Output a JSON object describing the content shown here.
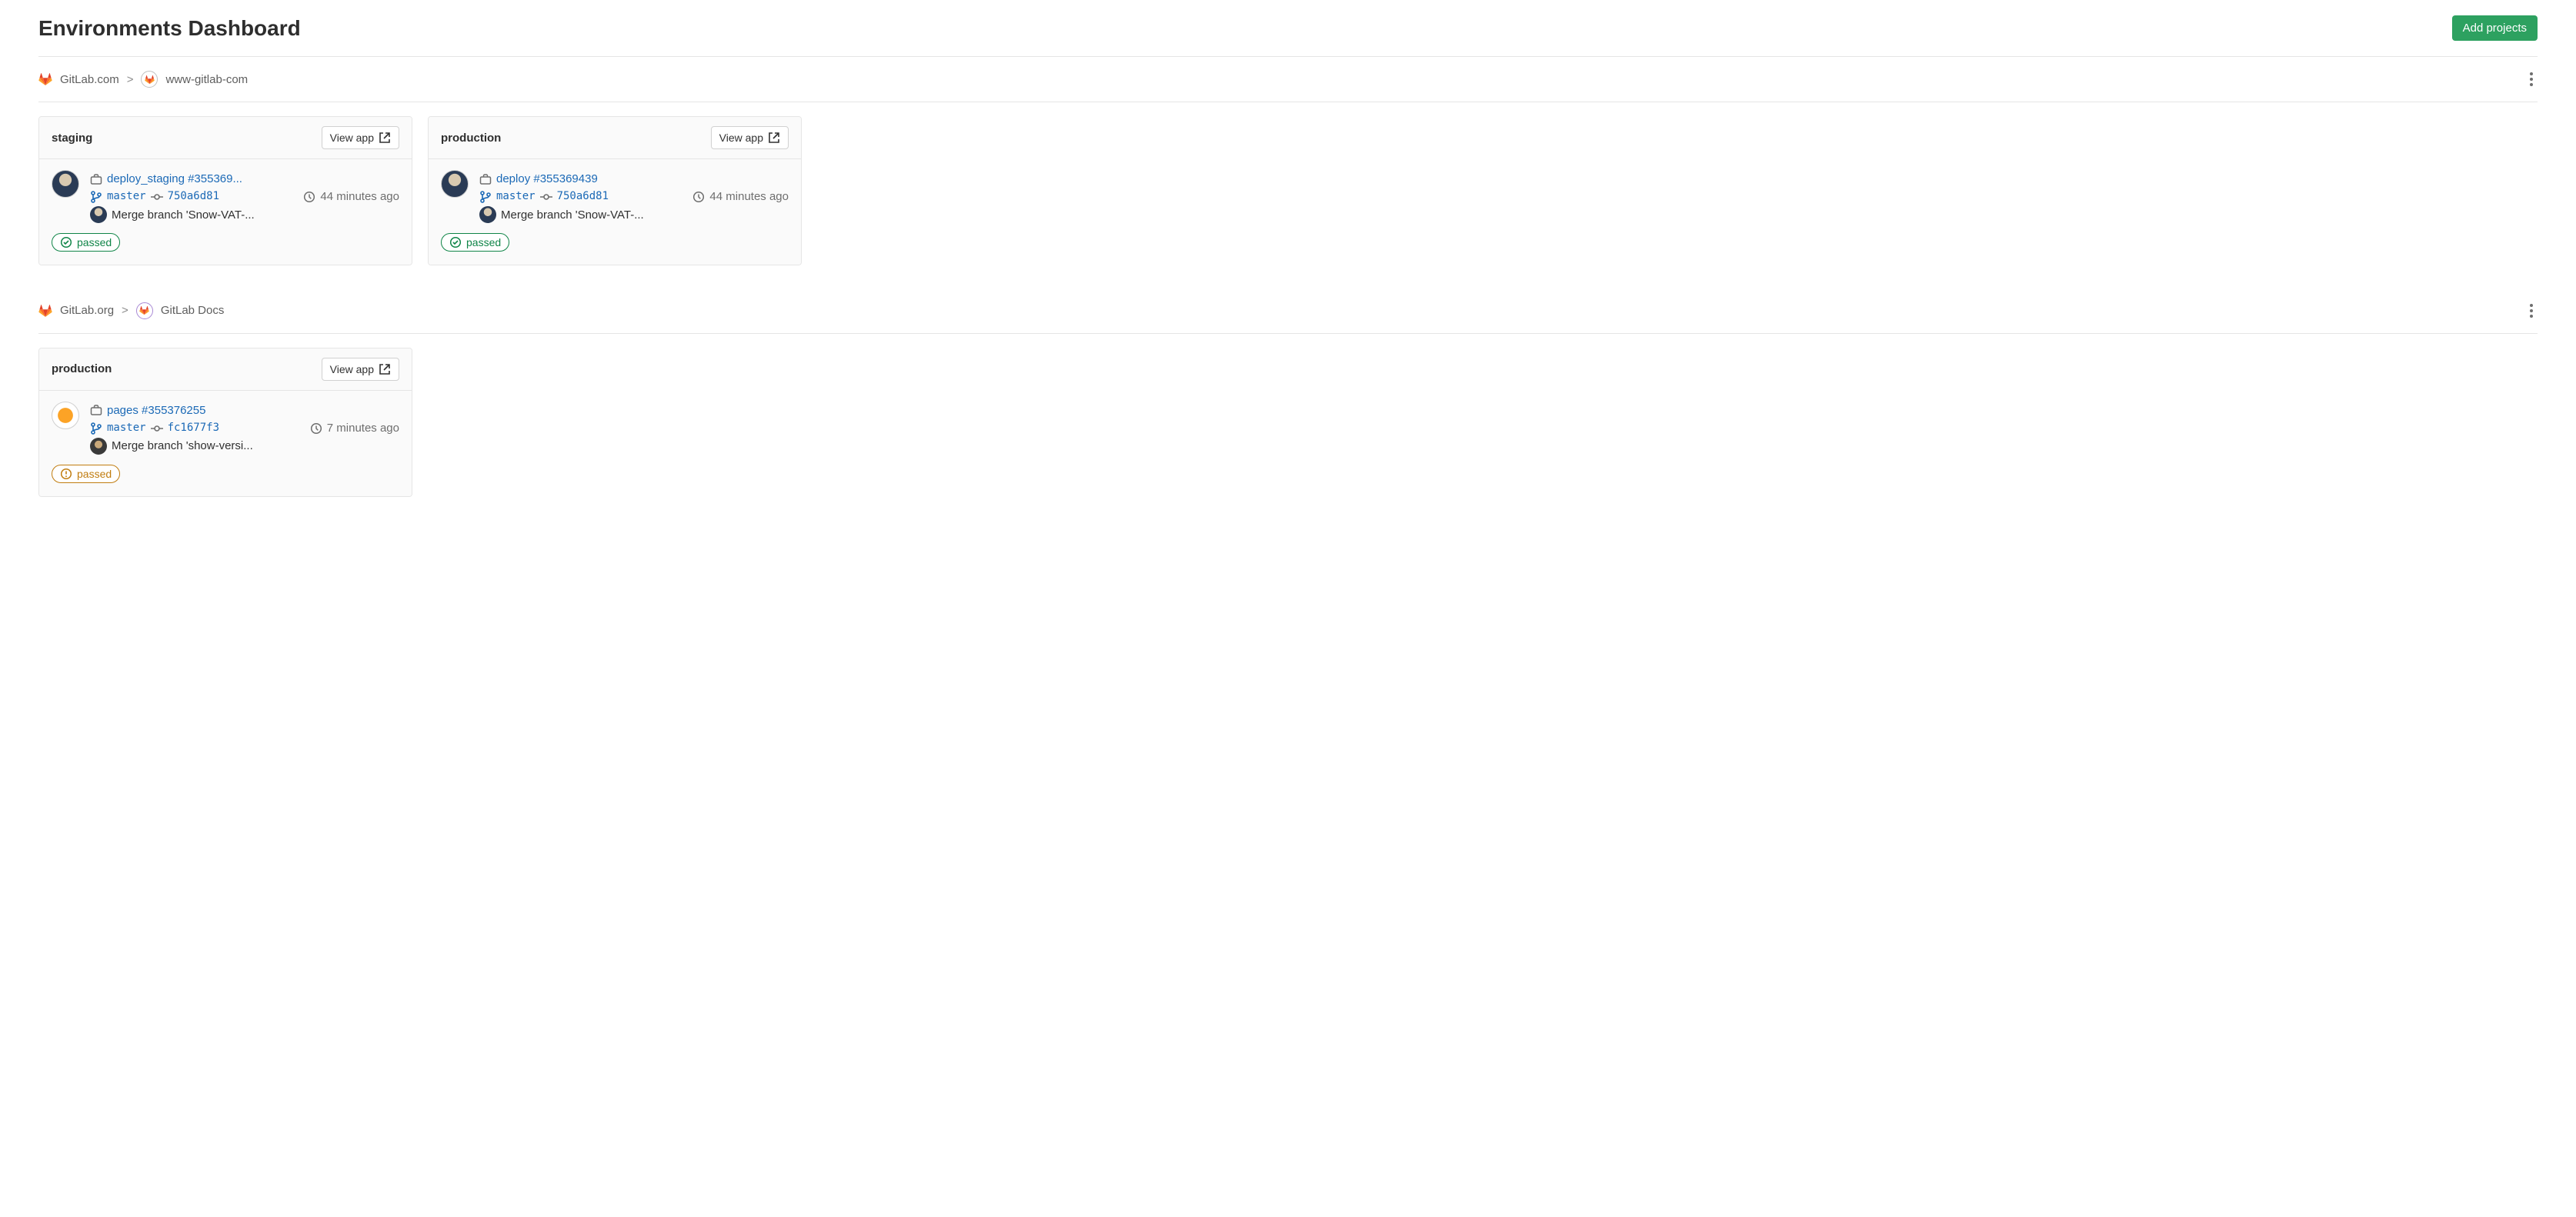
{
  "header": {
    "title": "Environments Dashboard",
    "add_projects_label": "Add projects"
  },
  "projects": [
    {
      "group_name": "GitLab.com",
      "project_name": "www-gitlab-com",
      "badge_variant": "default",
      "environments": [
        {
          "name": "staging",
          "view_app_label": "View app",
          "job_label": "deploy_staging #355369...",
          "branch": "master",
          "commit_sha": "750a6d81",
          "time_ago": "44 minutes ago",
          "commit_message": "Merge branch 'Snow-VAT-...",
          "status": {
            "label": "passed",
            "variant": "green"
          },
          "avatar_variant": "person"
        },
        {
          "name": "production",
          "view_app_label": "View app",
          "job_label": "deploy #355369439",
          "branch": "master",
          "commit_sha": "750a6d81",
          "time_ago": "44 minutes ago",
          "commit_message": "Merge branch 'Snow-VAT-...",
          "status": {
            "label": "passed",
            "variant": "green"
          },
          "avatar_variant": "person"
        }
      ]
    },
    {
      "group_name": "GitLab.org",
      "project_name": "GitLab Docs",
      "badge_variant": "purple",
      "environments": [
        {
          "name": "production",
          "view_app_label": "View app",
          "job_label": "pages #355376255",
          "branch": "master",
          "commit_sha": "fc1677f3",
          "time_ago": "7 minutes ago",
          "commit_message": "Merge branch 'show-versi...",
          "status": {
            "label": "passed",
            "variant": "orange"
          },
          "avatar_variant": "tanuki",
          "committer_variant": "dark"
        }
      ]
    }
  ]
}
